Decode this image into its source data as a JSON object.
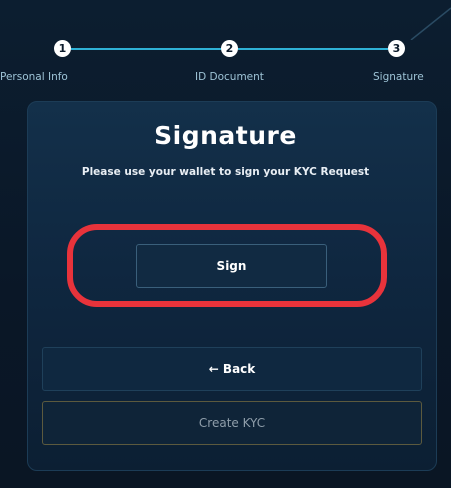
{
  "stepper": {
    "steps": [
      {
        "number": "1",
        "label": "Personal Info"
      },
      {
        "number": "2",
        "label": "ID Document"
      },
      {
        "number": "3",
        "label": "Signature"
      }
    ]
  },
  "card": {
    "title": "Signature",
    "subtitle": "Please use your wallet to sign your KYC Request",
    "sign_label": "Sign",
    "back_label": "← Back",
    "create_label": "Create KYC"
  },
  "colors": {
    "accent": "#2fb1d6",
    "highlight": "#e8333b",
    "background": "#0b1a2a"
  }
}
